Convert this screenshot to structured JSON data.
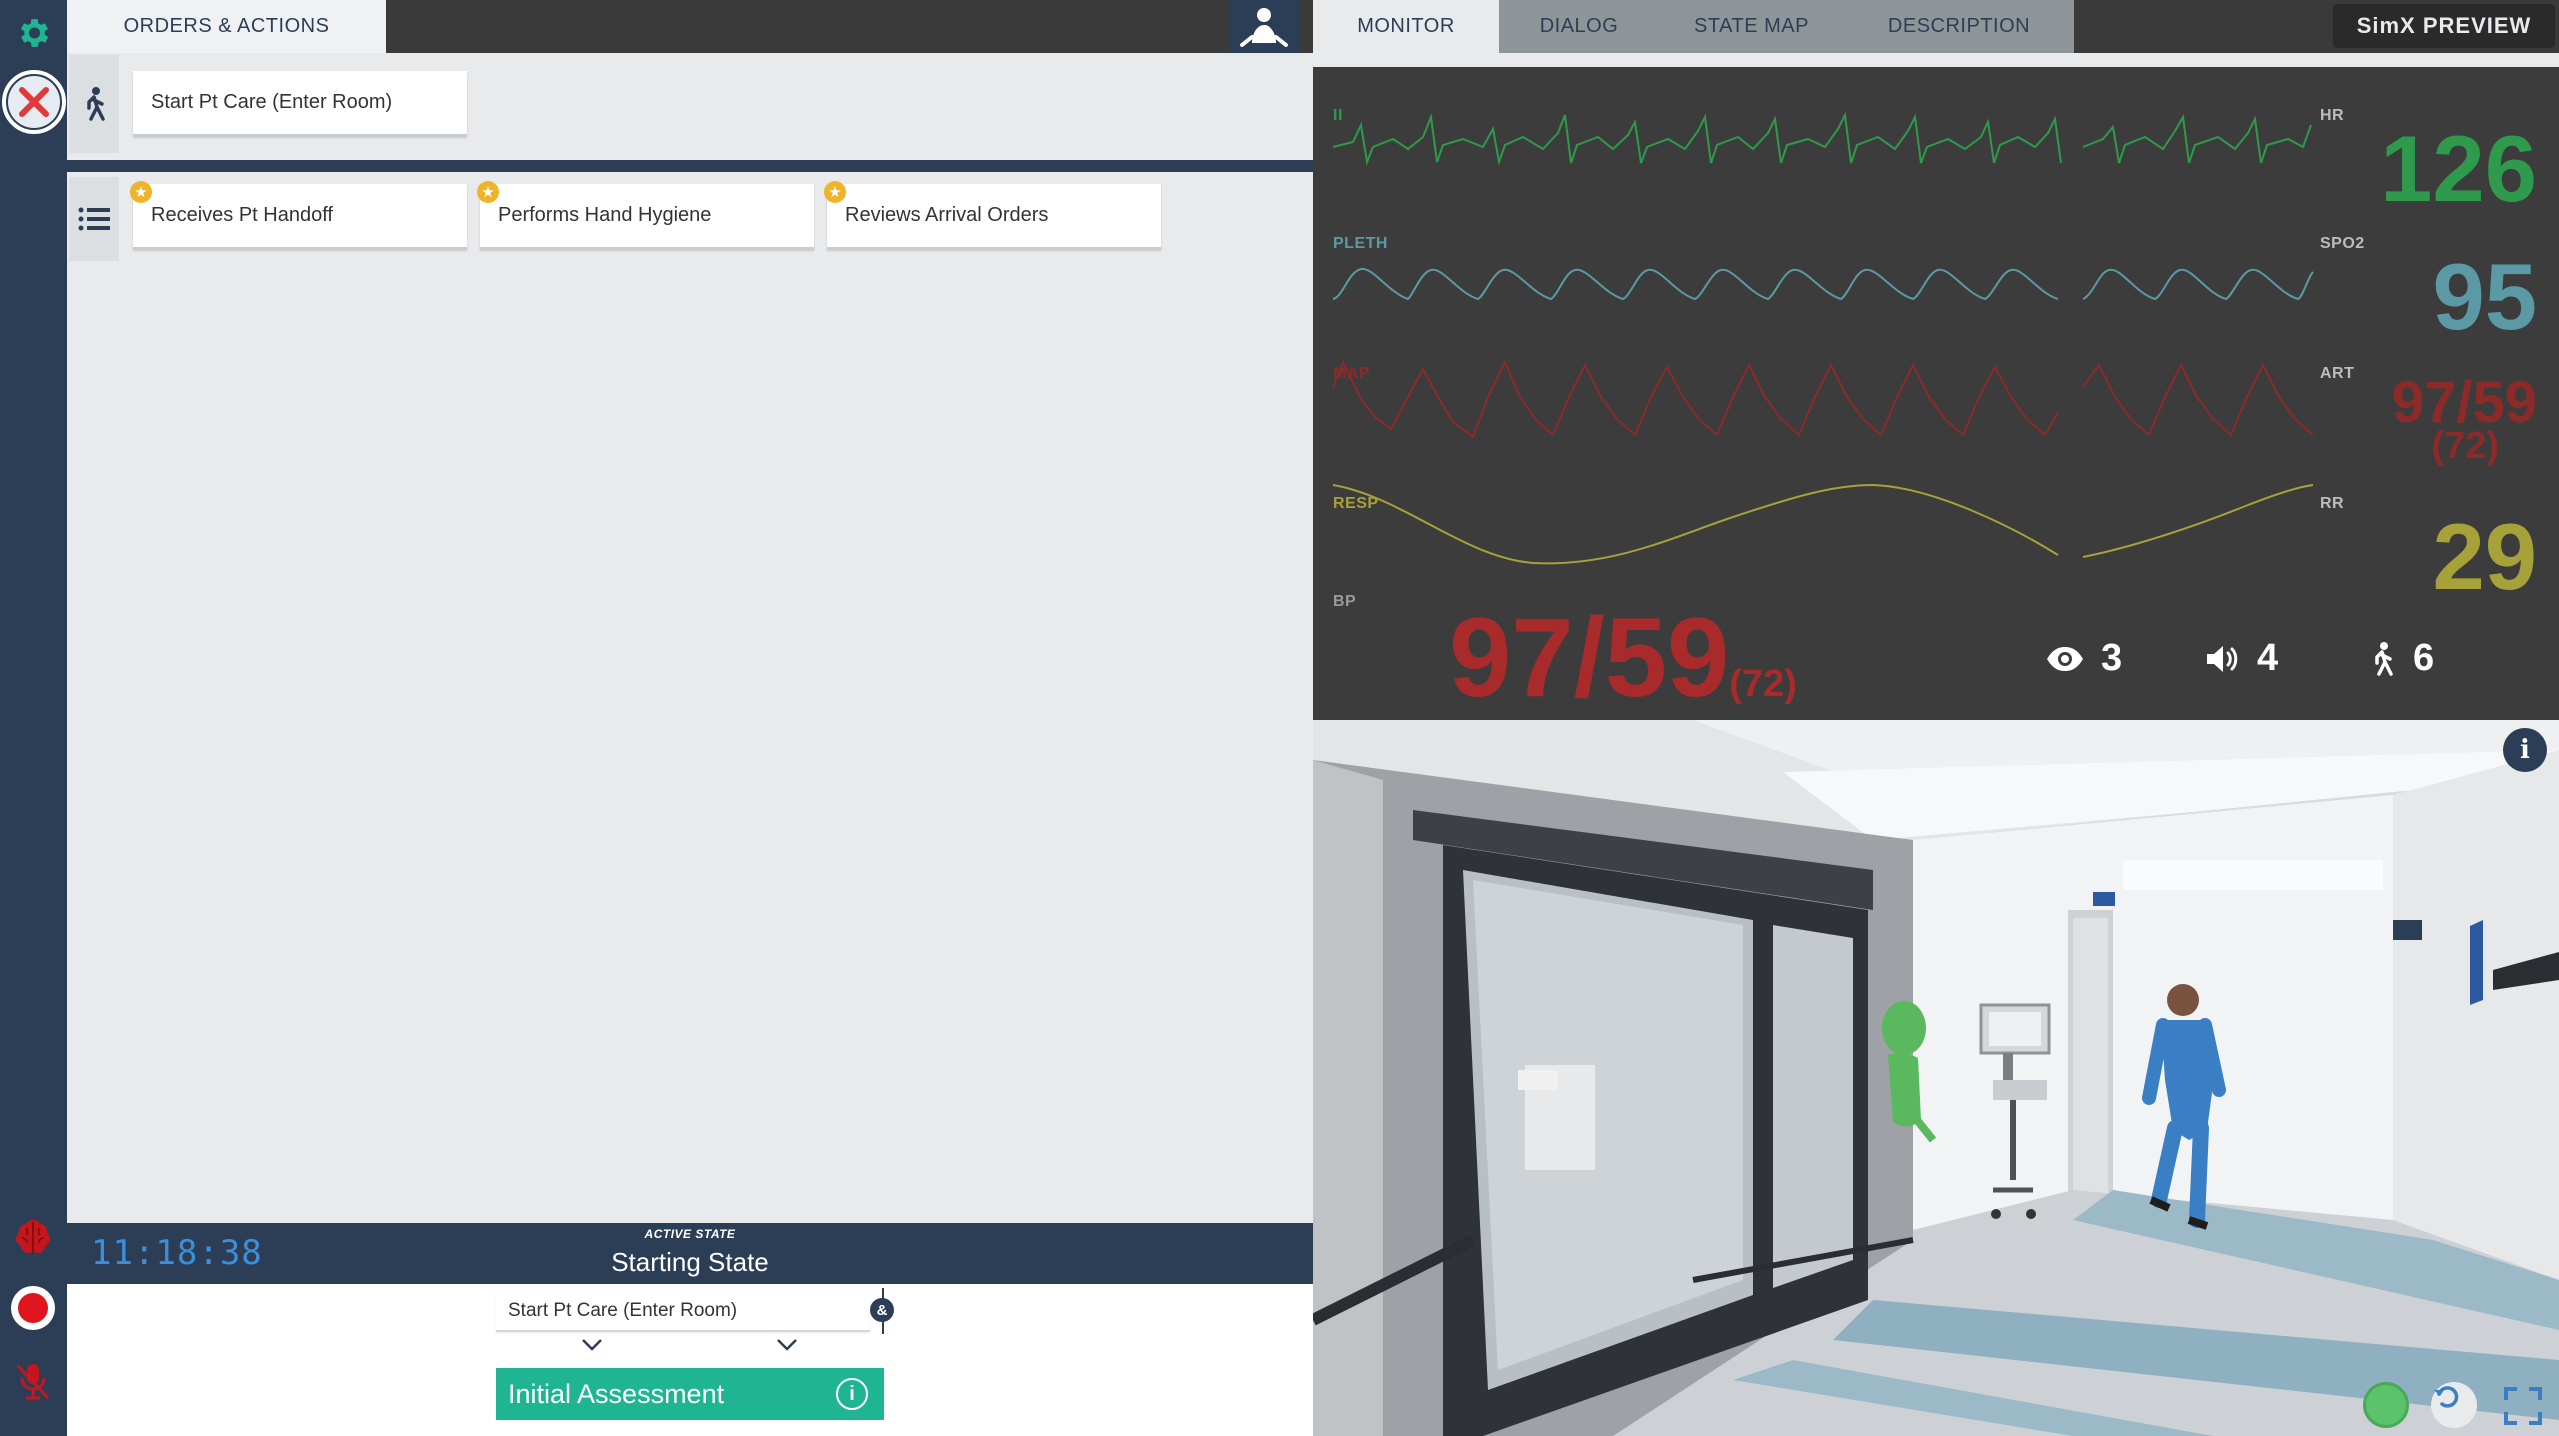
{
  "app": {
    "preview_label": "SimX PREVIEW"
  },
  "left_tabs": {
    "orders_actions": "ORDERS & ACTIONS"
  },
  "right_tabs": [
    {
      "label": "MONITOR",
      "active": true
    },
    {
      "label": "DIALOG",
      "active": false
    },
    {
      "label": "STATE MAP",
      "active": false
    },
    {
      "label": "DESCRIPTION",
      "active": false
    }
  ],
  "actions": {
    "primary": {
      "label": "Start Pt Care (Enter Room)",
      "icon": "walking-person-icon"
    },
    "checklist_icon": "list-icon",
    "checklist": [
      {
        "label": "Receives Pt Handoff",
        "starred": true
      },
      {
        "label": "Performs Hand Hygiene",
        "starred": true
      },
      {
        "label": "Reviews Arrival Orders",
        "starred": true
      }
    ]
  },
  "status_bar": {
    "clock": "11:18:38",
    "active_state_kicker": "ACTIVE STATE",
    "active_state_name": "Starting State"
  },
  "transition": {
    "condition": "Start Pt Care (Enter Room)",
    "operator": "&",
    "next_state": "Initial Assessment"
  },
  "monitor": {
    "lead_label": "II",
    "hr": {
      "label": "HR",
      "value": "126",
      "color": "#2e9a4b"
    },
    "spo2": {
      "label": "SPO2",
      "value": "95",
      "color": "#5b9aa5",
      "wave_label": "PLETH"
    },
    "art": {
      "label": "ART",
      "value": "97/59",
      "mean": "(72)",
      "color": "#8c2a2a",
      "wave_label": "MAP"
    },
    "rr": {
      "label": "RR",
      "value": "29",
      "color": "#a7a13a",
      "wave_label": "RESP"
    },
    "bp": {
      "label": "BP",
      "value": "97/59",
      "mean": "(72)",
      "color": "#a82a2a"
    },
    "counters": [
      {
        "icon": "eye-icon",
        "value": "3"
      },
      {
        "icon": "speaker-icon",
        "value": "4"
      },
      {
        "icon": "walking-person-icon",
        "value": "6"
      }
    ]
  },
  "scene": {
    "info_label": "i",
    "controls": [
      "status-indicator",
      "reset-view-icon",
      "fullscreen-icon"
    ]
  },
  "colors": {
    "navy": "#2c3e55",
    "teal": "#1fb593",
    "topbar": "#3a3a3a",
    "monitor_bg": "#3c3c3c"
  }
}
